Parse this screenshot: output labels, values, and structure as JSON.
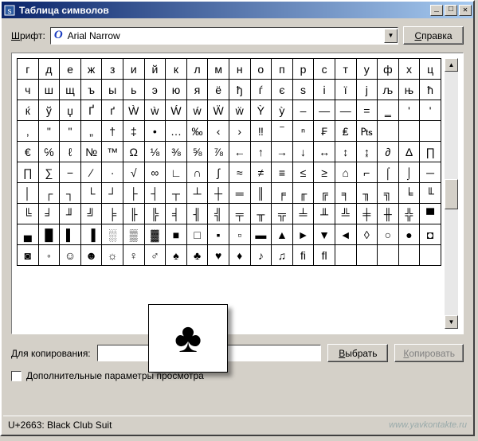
{
  "window": {
    "title": "Таблица символов"
  },
  "font_row": {
    "label": "Шрифт:",
    "font": "Arial Narrow"
  },
  "help_button": "Справка",
  "grid_rows": [
    [
      "г",
      "д",
      "е",
      "ж",
      "з",
      "и",
      "й",
      "к",
      "л",
      "м",
      "н",
      "о",
      "п",
      "р",
      "с",
      "т",
      "у",
      "ф",
      "х",
      "ц"
    ],
    [
      "ч",
      "ш",
      "щ",
      "ъ",
      "ы",
      "ь",
      "э",
      "ю",
      "я",
      "ё",
      "ђ",
      "ѓ",
      "є",
      "ѕ",
      "і",
      "ї",
      "ј",
      "љ",
      "њ",
      "ћ"
    ],
    [
      "ќ",
      "ў",
      "џ",
      "Ґ",
      "ґ",
      "Ẁ",
      "ẁ",
      "Ẃ",
      "ẃ",
      "Ẅ",
      "ẅ",
      "Ỳ",
      "ỳ",
      "–",
      "—",
      "―",
      "=",
      "‗",
      "'",
      "'"
    ],
    [
      "‚",
      "\"",
      "\"",
      "„",
      "†",
      "‡",
      "•",
      "…",
      "‰",
      "‹",
      "›",
      "‼",
      "‾",
      "ⁿ",
      "₣",
      "₤",
      "₧",
      " ",
      " ",
      " "
    ],
    [
      "€",
      "℅",
      "ℓ",
      "№",
      "™",
      "Ω",
      "⅛",
      "⅜",
      "⅝",
      "⅞",
      "←",
      "↑",
      "→",
      "↓",
      "↔",
      "↕",
      "↨",
      "∂",
      "∆",
      "∏"
    ],
    [
      "∏",
      "∑",
      "−",
      "∕",
      "∙",
      "√",
      "∞",
      "∟",
      "∩",
      "∫",
      "≈",
      "≠",
      "≡",
      "≤",
      "≥",
      "⌂",
      "⌐",
      "⌠",
      "⌡",
      "─"
    ],
    [
      "│",
      "┌",
      "┐",
      "└",
      "┘",
      "├",
      "┤",
      "┬",
      "┴",
      "┼",
      "═",
      "║",
      "╒",
      "╓",
      "╔",
      "╕",
      "╖",
      "╗",
      "╘",
      "╙"
    ],
    [
      "╚",
      "╛",
      "╜",
      "╝",
      "╞",
      "╟",
      "╠",
      "╡",
      "╢",
      "╣",
      "╤",
      "╥",
      "╦",
      "╧",
      "╨",
      "╩",
      "╪",
      "╫",
      "╬",
      "▀"
    ],
    [
      "▄",
      "█",
      "▌",
      "▐",
      "░",
      "▒",
      "▓",
      "■",
      "□",
      "▪",
      "▫",
      "▬",
      "▲",
      "►",
      "▼",
      "◄",
      "◊",
      "○",
      "●",
      "◘"
    ],
    [
      "◙",
      "◦",
      "☺",
      "☻",
      "☼",
      "♀",
      "♂",
      "♠",
      "♣",
      "♥",
      "♦",
      "♪",
      "♫",
      "ﬁ",
      "ﬂ",
      "",
      "",
      "",
      "",
      ""
    ]
  ],
  "preview_char": "♣",
  "copy_row": {
    "label": "Для копирования:",
    "value": ""
  },
  "select_button": "Выбрать",
  "copy_button": "Копировать",
  "advanced_check": "Дополнительные параметры просмотра",
  "status": "U+2663: Black Club Suit",
  "watermark": "www.yavkontakte.ru"
}
